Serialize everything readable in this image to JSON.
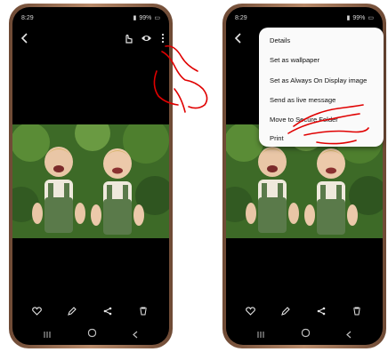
{
  "left_phone": {
    "status": {
      "time": "8:29",
      "battery": "99%"
    },
    "icons": [
      "back-icon",
      "hand-cursor-icon",
      "eye-icon",
      "more-options-icon"
    ],
    "bottom_actions": [
      "heart-icon",
      "edit-icon",
      "share-icon",
      "delete-icon"
    ],
    "nav": [
      "recent-apps-icon",
      "home-icon",
      "back-icon"
    ]
  },
  "right_phone": {
    "status": {
      "time": "8:29",
      "battery": "99%"
    },
    "menu": {
      "items": [
        "Details",
        "Set as wallpaper",
        "Set as Always On Display image",
        "Send as live message",
        "Move to Secure Folder",
        "Print"
      ]
    }
  },
  "annotations": {
    "color": "#e00000"
  }
}
